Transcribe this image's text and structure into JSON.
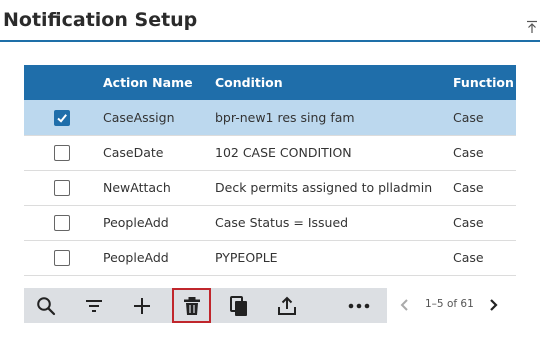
{
  "page": {
    "title": "Notification Setup"
  },
  "table": {
    "columns": [
      "Action Name",
      "Condition",
      "Function"
    ],
    "rows": [
      {
        "checked": true,
        "action": "CaseAssign",
        "condition": "bpr-new1 res sing fam",
        "function": "Case"
      },
      {
        "checked": false,
        "action": "CaseDate",
        "condition": "102 CASE CONDITION",
        "function": "Case"
      },
      {
        "checked": false,
        "action": "NewAttach",
        "condition": "Deck permits assigned to plladmin",
        "function": "Case"
      },
      {
        "checked": false,
        "action": "PeopleAdd",
        "condition": "Case Status = Issued",
        "function": "Case"
      },
      {
        "checked": false,
        "action": "PeopleAdd",
        "condition": "PYPEOPLE",
        "function": "Case"
      }
    ]
  },
  "toolbar": {
    "icons": [
      "search-icon",
      "filter-icon",
      "add-icon",
      "delete-icon",
      "copy-icon",
      "export-icon",
      "more-icon"
    ],
    "active": "delete-icon"
  },
  "pager": {
    "range": "1–5 of 61"
  },
  "colors": {
    "accent": "#1f6eaa",
    "selected_row": "#bcd8ee",
    "toolbar_bg": "#dcdfe3",
    "active_outline": "#c0262c"
  }
}
